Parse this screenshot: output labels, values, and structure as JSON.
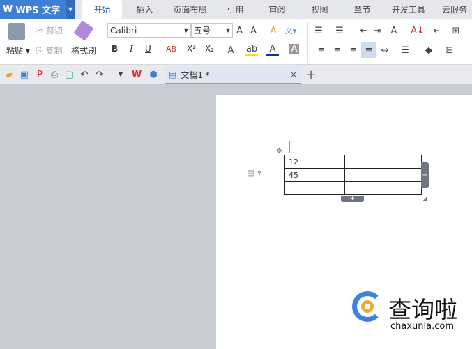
{
  "app": {
    "name": "WPS 文字"
  },
  "menu_tabs": [
    "开始",
    "插入",
    "页面布局",
    "引用",
    "审阅",
    "视图",
    "章节",
    "开发工具",
    "云服务"
  ],
  "ribbon": {
    "paste": "粘贴",
    "cut": "剪切",
    "copy": "复制",
    "format_painter": "格式刷",
    "font": "Calibri",
    "size": "五号",
    "bold": "B",
    "italic": "I",
    "underline": "U",
    "strike": "AB",
    "superscript": "X²",
    "subscript": "X₂"
  },
  "document_tab": {
    "title": "文档1 *"
  },
  "table": {
    "rows": [
      [
        "12",
        ""
      ],
      [
        "45",
        ""
      ],
      [
        "",
        ""
      ]
    ]
  },
  "watermark": {
    "name": "查询啦",
    "url": "chaxunla.com"
  }
}
